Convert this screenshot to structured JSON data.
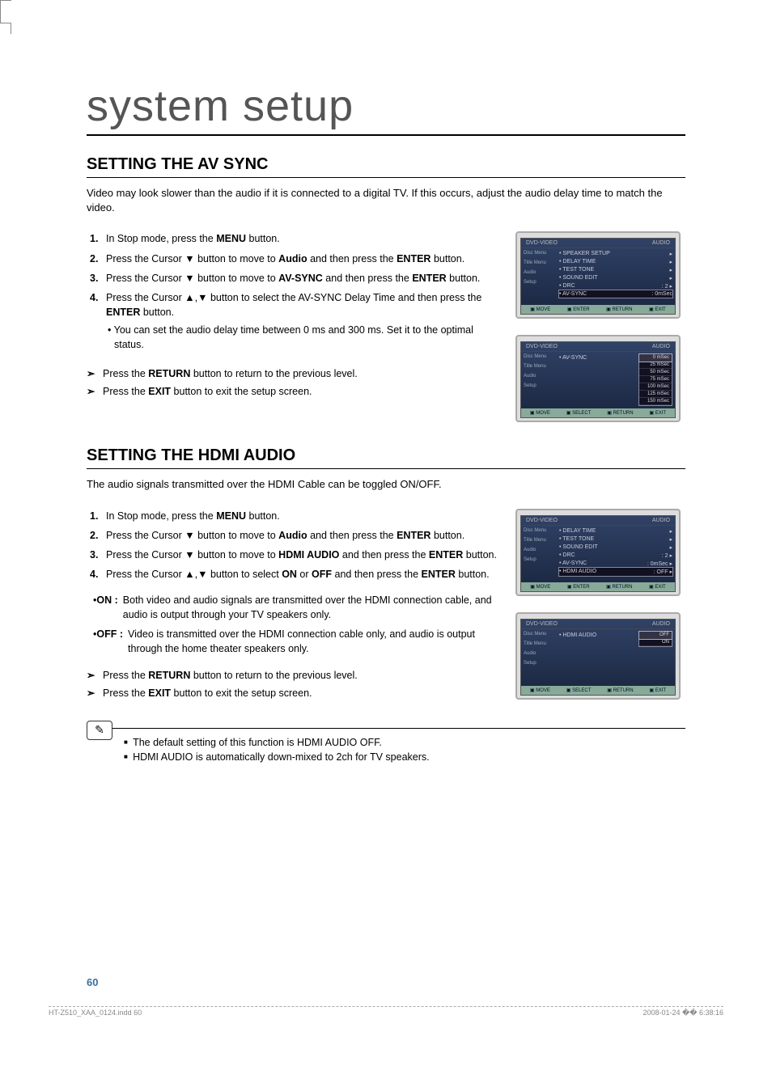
{
  "page": {
    "main_heading": "system setup",
    "page_number": "60",
    "footer_file": "HT-Z510_XAA_0124.indd   60",
    "footer_time": "2008-01-24   �� 6:38:16"
  },
  "section1": {
    "title": "SETTING THE AV SYNC",
    "intro": "Video may look slower than the audio if it is connected to a digital TV. If this occurs, adjust the audio delay time to match the video.",
    "steps": [
      {
        "num": "1.",
        "pre": "In Stop mode, press the ",
        "b1": "MENU",
        "post": " button."
      },
      {
        "num": "2.",
        "pre": "Press the Cursor ▼ button to move to ",
        "b1": "Audio",
        "mid": " and then press the ",
        "b2": "ENTER",
        "post": " button."
      },
      {
        "num": "3.",
        "pre": "Press the Cursor ▼ button to move to ",
        "b1": "AV-SYNC",
        "mid": " and then press the ",
        "b2": "ENTER",
        "post": " button."
      },
      {
        "num": "4.",
        "pre": "Press the Cursor ▲,▼ button to select the AV-SYNC Delay Time and then press the ",
        "b1": "ENTER",
        "post": " button.",
        "bullet": "You can set the audio delay time between 0 ms and 300 ms. Set it to the optimal status."
      }
    ],
    "arrows": [
      {
        "pre": "Press the ",
        "b1": "RETURN",
        "post": " button to return to the previous level."
      },
      {
        "pre": "Press the ",
        "b1": "EXIT",
        "post": " button to exit the setup screen."
      }
    ]
  },
  "section2": {
    "title": "SETTING THE HDMI AUDIO",
    "intro": "The audio signals transmitted over the HDMI Cable can be toggled ON/OFF.",
    "steps": [
      {
        "num": "1.",
        "pre": "In Stop mode, press the ",
        "b1": "MENU",
        "post": " button."
      },
      {
        "num": "2.",
        "pre": "Press the Cursor  ▼ button to move to ",
        "b1": "Audio",
        "mid": " and then press the ",
        "b2": "ENTER",
        "post": " button."
      },
      {
        "num": "3.",
        "pre": "Press the Cursor ▼ button to move to ",
        "b1": "HDMI AUDIO",
        "mid": " and then press the ",
        "b2": "ENTER",
        "post": " button."
      },
      {
        "num": "4.",
        "pre": "Press the Cursor ▲,▼ button to select ",
        "b1": "ON",
        "mid": " or ",
        "b2": "OFF",
        "mid2": " and then press the ",
        "b3": "ENTER",
        "post": " button."
      }
    ],
    "defs": [
      {
        "term": "ON :",
        "body": "Both video and audio signals are transmitted over the HDMI connection cable, and audio is output through your TV speakers only."
      },
      {
        "term": "OFF :",
        "body": "Video is transmitted over the HDMI connection cable only, and audio is output through the home theater speakers only."
      }
    ],
    "arrows": [
      {
        "pre": "Press the ",
        "b1": "RETURN",
        "post": " button to return to the previous level."
      },
      {
        "pre": "Press the ",
        "b1": "EXIT",
        "post": " button to exit the setup screen."
      }
    ],
    "notes": [
      "The default setting of this function is HDMI AUDIO OFF.",
      "HDMI AUDIO is automatically down-mixed to 2ch for TV speakers."
    ]
  },
  "osd": {
    "dvd_label": "DVD-VIDEO",
    "audio_label": "AUDIO",
    "side_items": [
      "Disc Menu",
      "Title Menu",
      "Audio",
      "Setup"
    ],
    "menu1_rows": [
      {
        "lbl": "SPEAKER SETUP",
        "val": "",
        "arrow": "▸"
      },
      {
        "lbl": "DELAY TIME",
        "val": "",
        "arrow": "▸"
      },
      {
        "lbl": "TEST TONE",
        "val": "",
        "arrow": "▸"
      },
      {
        "lbl": "SOUND EDIT",
        "val": "",
        "arrow": "▸"
      },
      {
        "lbl": "DRC",
        "val": ": 2",
        "arrow": "▸"
      },
      {
        "lbl": "AV-SYNC",
        "val": ": 0mSec",
        "sel": true
      }
    ],
    "menu2_label": "AV-SYNC",
    "menu2_values": [
      "0 mSec",
      "25 mSec",
      "50 mSec",
      "75 mSec",
      "100 mSec",
      "125 mSec",
      "150 mSec"
    ],
    "menu3_rows": [
      {
        "lbl": "DELAY TIME",
        "val": "",
        "arrow": "▸"
      },
      {
        "lbl": "TEST TONE",
        "val": "",
        "arrow": "▸"
      },
      {
        "lbl": "SOUND EDIT",
        "val": "",
        "arrow": "▸"
      },
      {
        "lbl": "DRC",
        "val": ": 2",
        "arrow": "▸"
      },
      {
        "lbl": "AV-SYNC",
        "val": ": 0mSec",
        "arrow": "▸"
      },
      {
        "lbl": "HDMI AUDIO",
        "val": ": OFF",
        "sel": true,
        "arrow": "▸"
      }
    ],
    "menu4_label": "HDMI AUDIO",
    "menu4_values": [
      "OFF",
      "ON"
    ],
    "foot_move": "MOVE",
    "foot_enter": "ENTER",
    "foot_select": "SELECT",
    "foot_return": "RETURN",
    "foot_exit": "EXIT"
  }
}
